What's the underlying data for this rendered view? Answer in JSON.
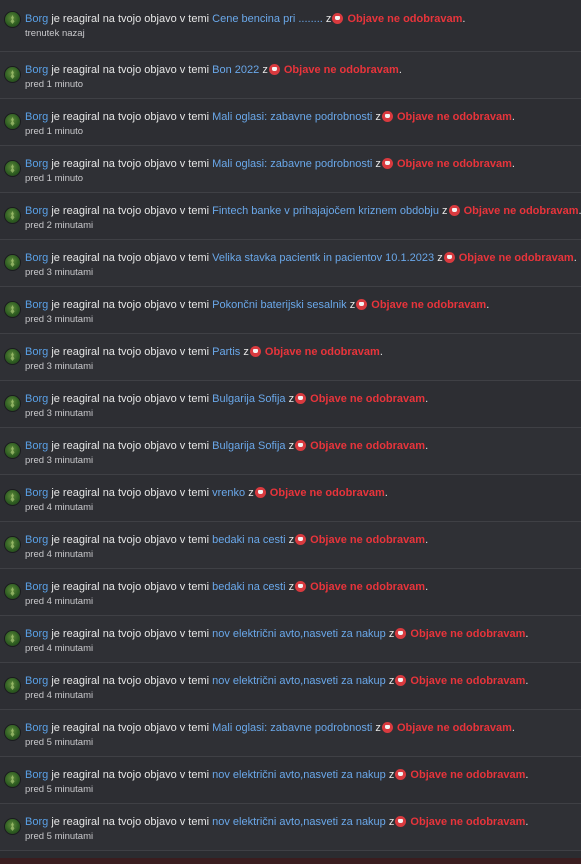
{
  "common": {
    "reacted_text": "je reagiral",
    "post_text": "na tvojo objavo v temi",
    "z": "z",
    "reaction_label": "Objave ne odobravam",
    "period": "."
  },
  "notifications": [
    {
      "user": "Borg",
      "topic": "Cene bencina pri ........",
      "time": "trenutek nazaj"
    },
    {
      "user": "Borg",
      "topic": "Bon 2022",
      "time": "pred 1 minuto"
    },
    {
      "user": "Borg",
      "topic": "Mali oglasi: zabavne podrobnosti",
      "time": "pred 1 minuto"
    },
    {
      "user": "Borg",
      "topic": "Mali oglasi: zabavne podrobnosti",
      "time": "pred 1 minuto"
    },
    {
      "user": "Borg",
      "topic": "Fintech banke v prihajajočem kriznem obdobju",
      "time": "pred 2 minutami"
    },
    {
      "user": "Borg",
      "topic": "Velika stavka pacientk in pacientov 10.1.2023",
      "time": "pred 3 minutami"
    },
    {
      "user": "Borg",
      "topic": "Pokončni baterijski sesalnik",
      "time": "pred 3 minutami"
    },
    {
      "user": "Borg",
      "topic": "Partis",
      "time": "pred 3 minutami"
    },
    {
      "user": "Borg",
      "topic": "Bulgarija Sofija",
      "time": "pred 3 minutami"
    },
    {
      "user": "Borg",
      "topic": "Bulgarija Sofija",
      "time": "pred 3 minutami"
    },
    {
      "user": "Borg",
      "topic": "vrenko",
      "time": "pred 4 minutami"
    },
    {
      "user": "Borg",
      "topic": "bedaki na cesti",
      "time": "pred 4 minutami"
    },
    {
      "user": "Borg",
      "topic": "bedaki na cesti",
      "time": "pred 4 minutami"
    },
    {
      "user": "Borg",
      "topic": "nov električni avto,nasveti za nakup",
      "time": "pred 4 minutami"
    },
    {
      "user": "Borg",
      "topic": "nov električni avto,nasveti za nakup",
      "time": "pred 4 minutami"
    },
    {
      "user": "Borg",
      "topic": "Mali oglasi: zabavne podrobnosti",
      "time": "pred 5 minutami"
    },
    {
      "user": "Borg",
      "topic": "nov električni avto,nasveti za nakup",
      "time": "pred 5 minutami"
    },
    {
      "user": "Borg",
      "topic": "nov električni avto,nasveti za nakup",
      "time": "pred 5 minutami"
    }
  ],
  "colors": {
    "background": "#2d2e33",
    "user_link": "#5aa0e6",
    "topic_link": "#6aa8ea",
    "reaction": "#e8343b"
  }
}
